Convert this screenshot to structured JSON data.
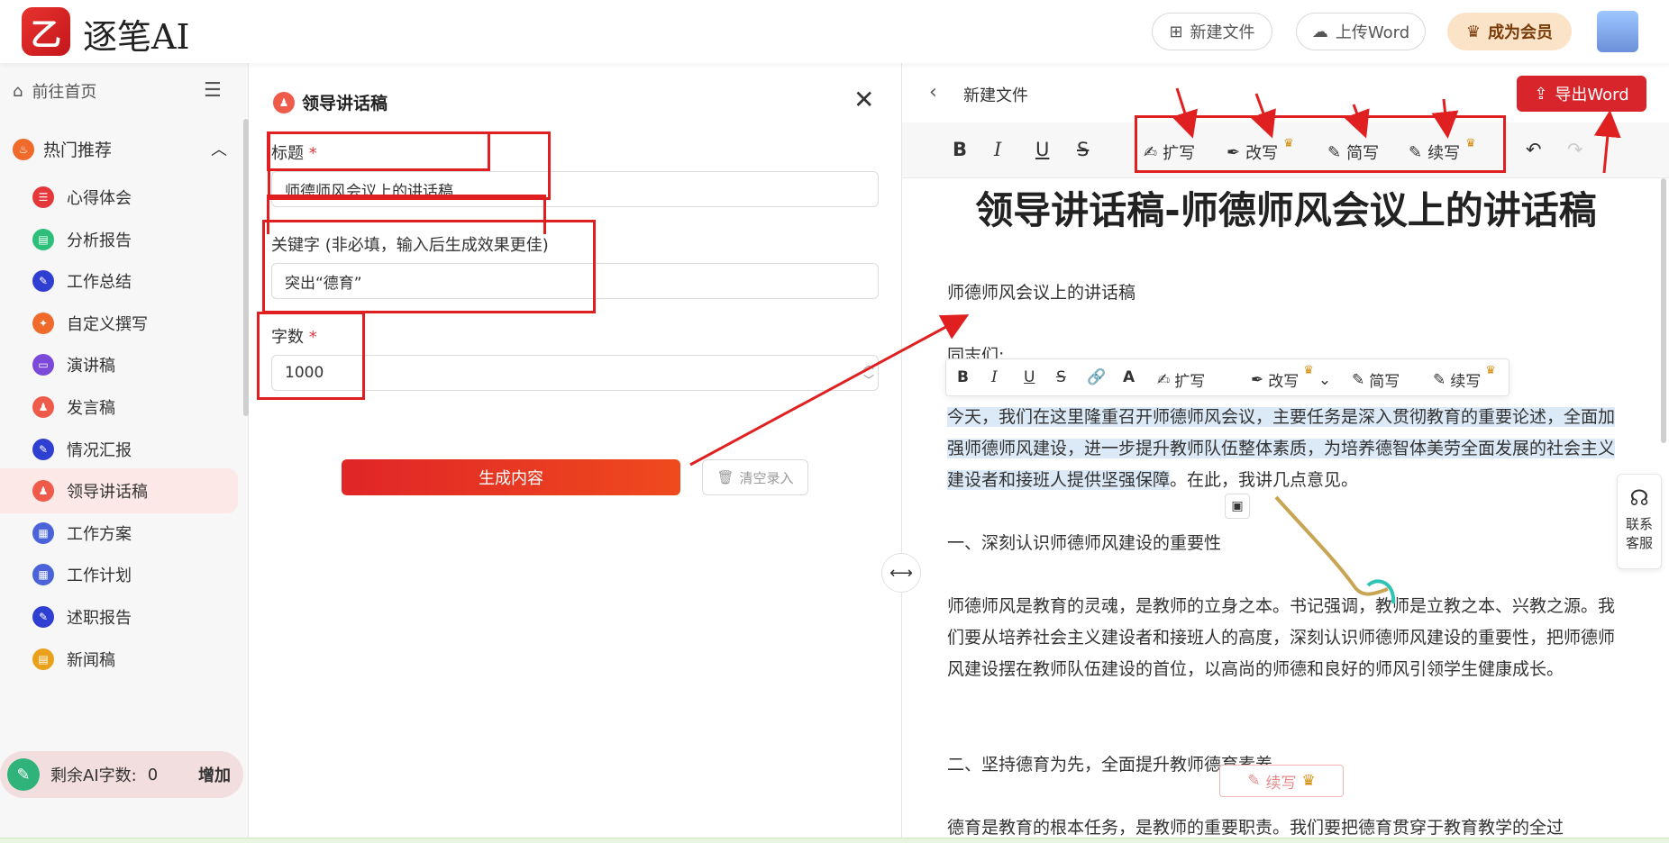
{
  "header": {
    "logo_glyph": "乙",
    "app_name": "逐笔AI",
    "new_file": "新建文件",
    "upload_word": "上传Word",
    "member": "成为会员"
  },
  "sidebar": {
    "home": "前往首页",
    "group": "热门推荐",
    "items": [
      {
        "label": "心得体会",
        "color": "#e5383b"
      },
      {
        "label": "分析报告",
        "color": "#2bbf7a"
      },
      {
        "label": "工作总结",
        "color": "#2f3fd1"
      },
      {
        "label": "自定义撰写",
        "color": "#f06b2b"
      },
      {
        "label": "演讲稿",
        "color": "#7c4ad9"
      },
      {
        "label": "发言稿",
        "color": "#ef5b4b"
      },
      {
        "label": "情况汇报",
        "color": "#2f3fd1"
      },
      {
        "label": "领导讲话稿",
        "color": "#ef5b4b"
      },
      {
        "label": "工作方案",
        "color": "#4a63d9"
      },
      {
        "label": "工作计划",
        "color": "#4a63d9"
      },
      {
        "label": "述职报告",
        "color": "#2f3fd1"
      },
      {
        "label": "新闻稿",
        "color": "#e9a11c"
      }
    ],
    "footer_label": "剩余AI字数:",
    "footer_count": "0",
    "footer_add": "增加"
  },
  "form": {
    "title": "领导讲话稿",
    "title_label": "标题",
    "title_value": "师德师风会议上的讲话稿",
    "keyword_label": "关键字 (非必填，输入后生成效果更佳)",
    "keyword_value": "突出“德育”",
    "words_label": "字数",
    "words_value": "1000",
    "generate": "生成内容",
    "clear": "清空录入"
  },
  "editor": {
    "doc_name": "新建文件",
    "export": "导出Word",
    "tools": {
      "bold": "B",
      "italic": "I",
      "underline": "U",
      "strike": "S"
    },
    "ai": {
      "expand": "扩写",
      "rewrite": "改写",
      "simplify": "简写",
      "continue": "续写"
    },
    "float_tools": {
      "link": "🔗",
      "color": "A"
    },
    "doc_title": "领导讲话稿-师德师风会议上的讲话稿",
    "para_subtitle": "师德师风会议上的讲话稿",
    "para_greeting": "同志们:",
    "para_intro_hl": "今天，我们在这里隆重召开师德师风会议，主要任务是深入贯彻教育的重要论述，全面加强师德师风建设，进一步提升教师队伍整体素质，为培养德智体美劳全面发展的社会主义建设者和接班人提供坚强保障",
    "para_intro_rest": "。在此，我讲几点意见。",
    "section1": "一、深刻认识师德师风建设的重要性",
    "para1": "师德师风是教育的灵魂，是教师的立身之本。书记强调，教师是立教之本、兴教之源。我们要从培养社会主义建设者和接班人的高度，深刻认识师德师风建设的重要性，把师德师风建设摆在教师队伍建设的首位，以高尚的师德和良好的师风引领学生健康成长。",
    "section2": "二、坚持德育为先，全面提升教师德育素养",
    "para2": "德育是教育的根本任务，是教师的重要职责。我们要把德育贯穿于教育教学的全过"
  },
  "service": {
    "line1": "联系",
    "line2": "客服"
  }
}
